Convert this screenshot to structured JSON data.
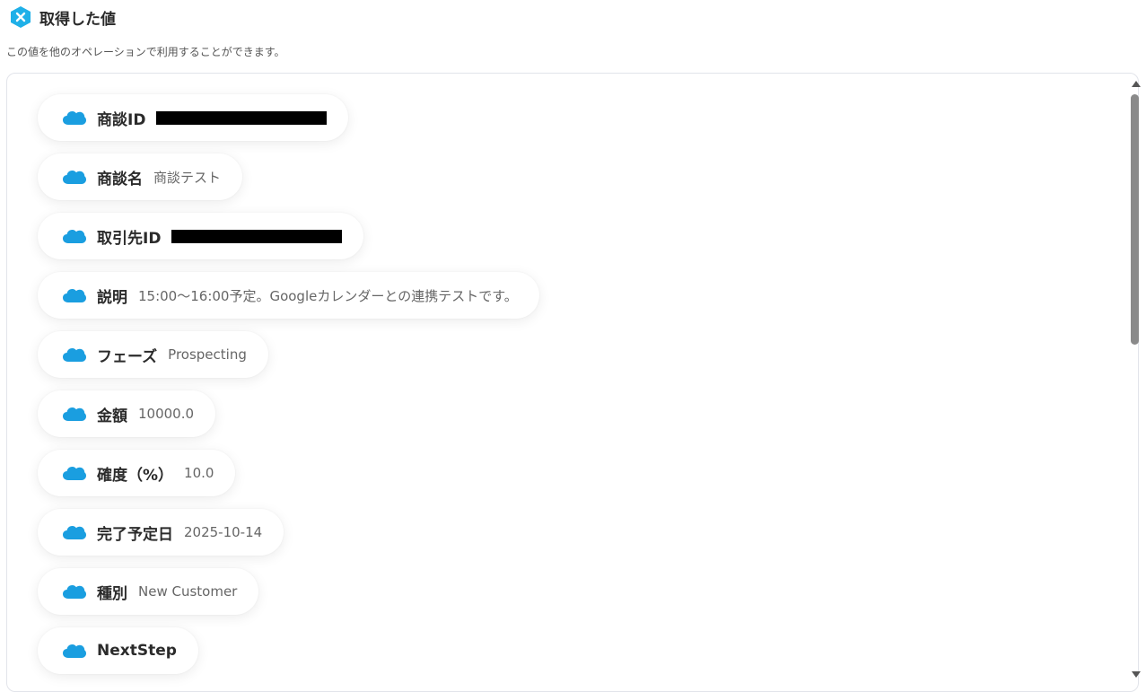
{
  "header": {
    "title": "取得した値",
    "logo_icon": "yoom-logo-icon",
    "accent_color": "#1fb0e8"
  },
  "description": "この値を他のオペレーションで利用することができます。",
  "icon_color": "#1a9ee0",
  "fields": [
    {
      "label": "商談ID",
      "value": "",
      "redacted": true
    },
    {
      "label": "商談名",
      "value": "商談テスト",
      "redacted": false
    },
    {
      "label": "取引先ID",
      "value": "",
      "redacted": true
    },
    {
      "label": "説明",
      "value": "15:00〜16:00予定。Googleカレンダーとの連携テストです。",
      "redacted": false
    },
    {
      "label": "フェーズ",
      "value": "Prospecting",
      "redacted": false
    },
    {
      "label": "金額",
      "value": "10000.0",
      "redacted": false
    },
    {
      "label": "確度（%）",
      "value": "10.0",
      "redacted": false
    },
    {
      "label": "完了予定日",
      "value": "2025-10-14",
      "redacted": false
    },
    {
      "label": "種別",
      "value": "New Customer",
      "redacted": false
    },
    {
      "label": "NextStep",
      "value": "",
      "redacted": false
    }
  ]
}
